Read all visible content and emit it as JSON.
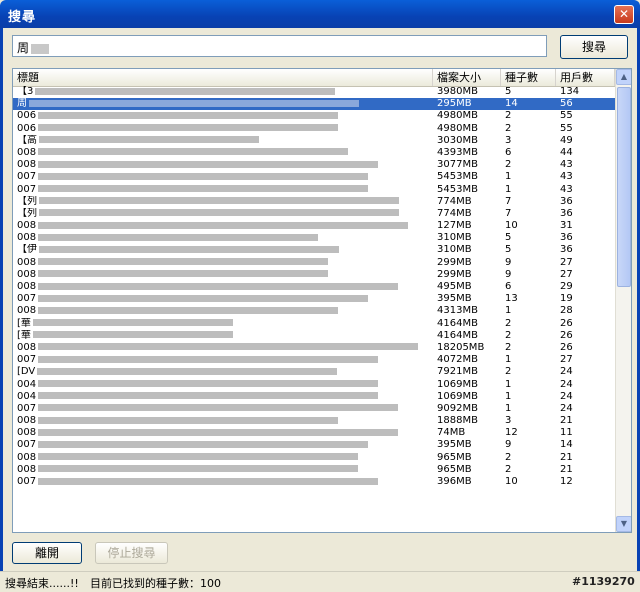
{
  "window": {
    "title": "搜尋",
    "close_glyph": "✕"
  },
  "search": {
    "value": "周"
  },
  "buttons": {
    "search": "搜尋",
    "close": "離開",
    "stop": "停止搜尋"
  },
  "columns": [
    "標題",
    "檔案大小",
    "種子數",
    "用戶數"
  ],
  "rows": [
    {
      "title": "【3",
      "size": "3980MB",
      "seeds": "5",
      "users": "134"
    },
    {
      "title": "周",
      "size": "295MB",
      "seeds": "14",
      "users": "56",
      "selected": true
    },
    {
      "title": "006",
      "size": "4980MB",
      "seeds": "2",
      "users": "55"
    },
    {
      "title": "006",
      "size": "4980MB",
      "seeds": "2",
      "users": "55"
    },
    {
      "title": "【高",
      "size": "3030MB",
      "seeds": "3",
      "users": "49"
    },
    {
      "title": "008",
      "size": "4393MB",
      "seeds": "6",
      "users": "44"
    },
    {
      "title": "008",
      "size": "3077MB",
      "seeds": "2",
      "users": "43"
    },
    {
      "title": "007",
      "size": "5453MB",
      "seeds": "1",
      "users": "43"
    },
    {
      "title": "007",
      "size": "5453MB",
      "seeds": "1",
      "users": "43"
    },
    {
      "title": "【列",
      "size": "774MB",
      "seeds": "7",
      "users": "36"
    },
    {
      "title": "【列",
      "size": "774MB",
      "seeds": "7",
      "users": "36"
    },
    {
      "title": "008",
      "size": "127MB",
      "seeds": "10",
      "users": "31"
    },
    {
      "title": "008",
      "size": "310MB",
      "seeds": "5",
      "users": "36"
    },
    {
      "title": "【伊",
      "size": "310MB",
      "seeds": "5",
      "users": "36"
    },
    {
      "title": "008",
      "size": "299MB",
      "seeds": "9",
      "users": "27"
    },
    {
      "title": "008",
      "size": "299MB",
      "seeds": "9",
      "users": "27"
    },
    {
      "title": "008",
      "size": "495MB",
      "seeds": "6",
      "users": "29"
    },
    {
      "title": "007",
      "size": "395MB",
      "seeds": "13",
      "users": "19"
    },
    {
      "title": "008",
      "size": "4313MB",
      "seeds": "1",
      "users": "28"
    },
    {
      "title": "[華",
      "size": "4164MB",
      "seeds": "2",
      "users": "26"
    },
    {
      "title": "[華",
      "size": "4164MB",
      "seeds": "2",
      "users": "26"
    },
    {
      "title": "008",
      "size": "18205MB",
      "seeds": "2",
      "users": "26"
    },
    {
      "title": "007",
      "size": "4072MB",
      "seeds": "1",
      "users": "27"
    },
    {
      "title": "[DV",
      "size": "7921MB",
      "seeds": "2",
      "users": "24"
    },
    {
      "title": "004",
      "size": "1069MB",
      "seeds": "1",
      "users": "24"
    },
    {
      "title": "004",
      "size": "1069MB",
      "seeds": "1",
      "users": "24"
    },
    {
      "title": "007",
      "size": "9092MB",
      "seeds": "1",
      "users": "24"
    },
    {
      "title": "008",
      "size": "1888MB",
      "seeds": "3",
      "users": "21"
    },
    {
      "title": "008",
      "size": "74MB",
      "seeds": "12",
      "users": "11"
    },
    {
      "title": "007",
      "size": "395MB",
      "seeds": "9",
      "users": "14"
    },
    {
      "title": "008",
      "size": "965MB",
      "seeds": "2",
      "users": "21"
    },
    {
      "title": "008",
      "size": "965MB",
      "seeds": "2",
      "users": "21"
    },
    {
      "title": "007",
      "size": "396MB",
      "seeds": "10",
      "users": "12"
    }
  ],
  "status": {
    "text": "搜尋結束......!!",
    "count": "目前已找到的種子數：100"
  },
  "watermark": "#1139270",
  "colors": {
    "titlebar": "#0842b4",
    "selection": "#316ac5",
    "background": "#ece9d8"
  }
}
